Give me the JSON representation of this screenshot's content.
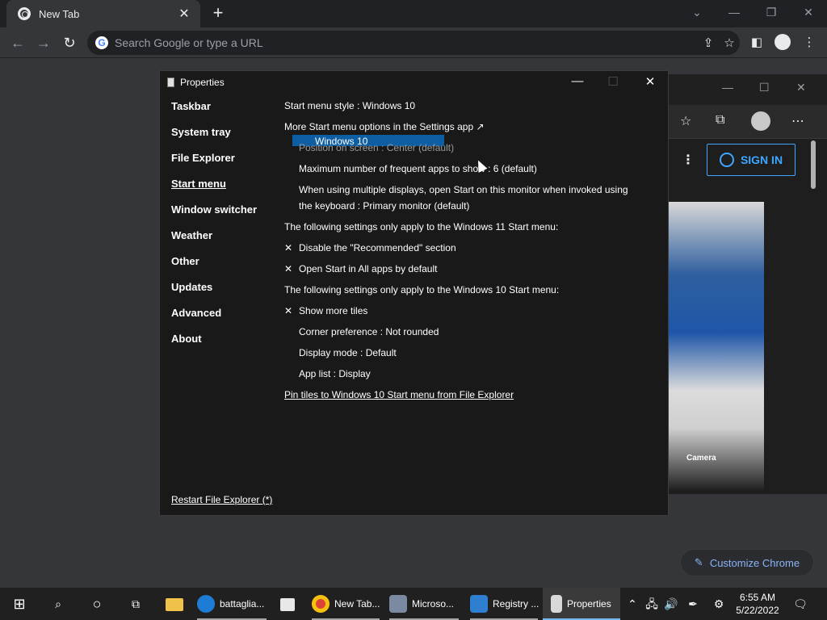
{
  "browser": {
    "tab_title": "New Tab",
    "tab_close": "✕",
    "new_tab": "+",
    "omnibox_placeholder": "Search Google or type a URL",
    "google_letter": "G",
    "customize_label": "Customize Chrome"
  },
  "edge": {
    "signin_label": "SIGN IN",
    "camera_label": "Camera"
  },
  "dialog": {
    "title": "Properties",
    "nav": [
      "Taskbar",
      "System tray",
      "File Explorer",
      "Start menu",
      "Window switcher",
      "Weather",
      "Other",
      "Updates",
      "Advanced",
      "About"
    ],
    "active_nav": "Start menu",
    "restart_label": "Restart File Explorer (*)",
    "lines": {
      "style": "Start menu style : Windows 10",
      "more_options": "More Start menu options in the Settings app ↗",
      "dropdown_selected": "Windows 10",
      "position": "Position on screen : Center (default)",
      "max_frequent": "Maximum number of frequent apps to show : 6 (default)",
      "multi_display_1": "When using multiple displays, open Start on this monitor when invoked using",
      "multi_display_2": "the keyboard : Primary monitor (default)",
      "win11_header": "The following settings only apply to the Windows 11 Start menu:",
      "disable_recommended": "Disable the \"Recommended\" section",
      "open_all_apps": "Open Start in All apps by default",
      "win10_header": "The following settings only apply to the Windows 10 Start menu:",
      "show_more_tiles": "Show more tiles",
      "corner": "Corner preference : Not rounded",
      "display_mode": "Display mode : Default",
      "app_list": "App list : Display",
      "pin_tiles": "Pin tiles to Windows 10 Start menu from File Explorer"
    },
    "check_glyph": "✕"
  },
  "taskbar": {
    "items": [
      {
        "label": "battaglia...",
        "icon": "edge-icon"
      },
      {
        "label": "New Tab...",
        "icon": "chrome-icon"
      },
      {
        "label": "Microso...",
        "icon": "microsoft-store-icon"
      },
      {
        "label": "Registry ...",
        "icon": "registry-icon"
      },
      {
        "label": "Properties",
        "icon": "properties-icon"
      }
    ],
    "time": "6:55 AM",
    "date": "5/22/2022"
  },
  "colors": {
    "accent": "#3ea6ff",
    "selection": "#0e5ea3",
    "link": "#8ab4f8"
  }
}
